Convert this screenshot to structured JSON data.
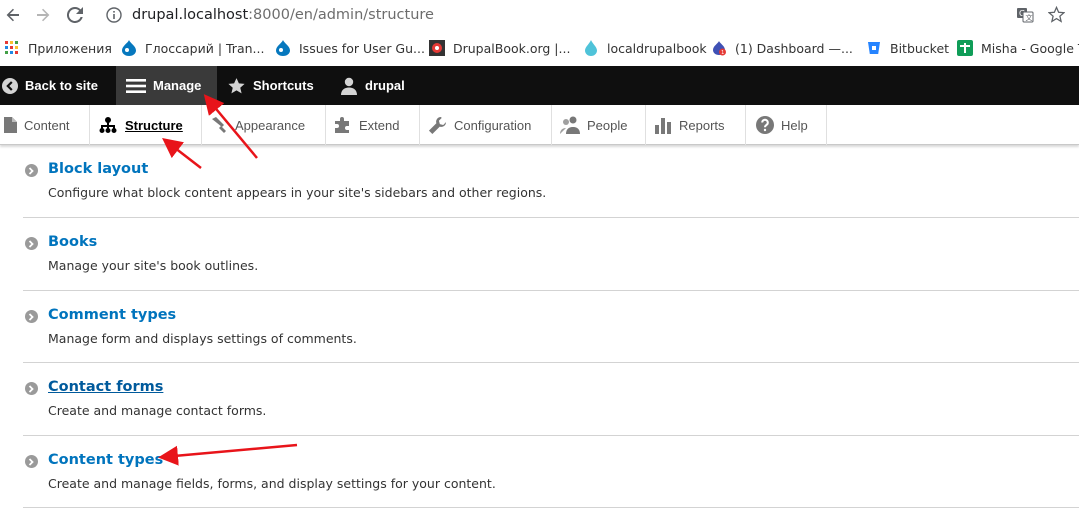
{
  "browser": {
    "url_host": "drupal.localhost",
    "url_path": ":8000/en/admin/structure"
  },
  "bookmarks": [
    {
      "label": "Приложения",
      "icon": "apps-grid-icon"
    },
    {
      "label": "Глоссарий | Tran...",
      "icon": "drupal-drop-icon"
    },
    {
      "label": "Issues for User Gu...",
      "icon": "drupal-drop-icon"
    },
    {
      "label": "DrupalBook.org |...",
      "icon": "drupalbook-icon"
    },
    {
      "label": "localdrupalbook",
      "icon": "water-drop-icon"
    },
    {
      "label": "(1) Dashboard —...",
      "icon": "dashboard-icon"
    },
    {
      "label": "Bitbucket",
      "icon": "bitbucket-icon"
    },
    {
      "label": "Misha - Google Ta",
      "icon": "google-tasks-icon"
    }
  ],
  "toolbar": {
    "back": "Back to site",
    "manage": "Manage",
    "shortcuts": "Shortcuts",
    "user": "drupal"
  },
  "tray": {
    "content": "Content",
    "structure": "Structure",
    "appearance": "Appearance",
    "extend": "Extend",
    "configuration": "Configuration",
    "people": "People",
    "reports": "Reports",
    "help": "Help"
  },
  "entries": [
    {
      "title": "Block layout",
      "desc": "Configure what block content appears in your site's sidebars and other regions."
    },
    {
      "title": "Books",
      "desc": "Manage your site's book outlines."
    },
    {
      "title": "Comment types",
      "desc": "Manage form and displays settings of comments."
    },
    {
      "title": "Contact forms",
      "desc": "Create and manage contact forms."
    },
    {
      "title": "Content types",
      "desc": "Create and manage fields, forms, and display settings for your content."
    }
  ],
  "colors": {
    "link": "#0074bd",
    "toolbar_bg": "#0f0f0f",
    "annotation": "#e8141a"
  }
}
